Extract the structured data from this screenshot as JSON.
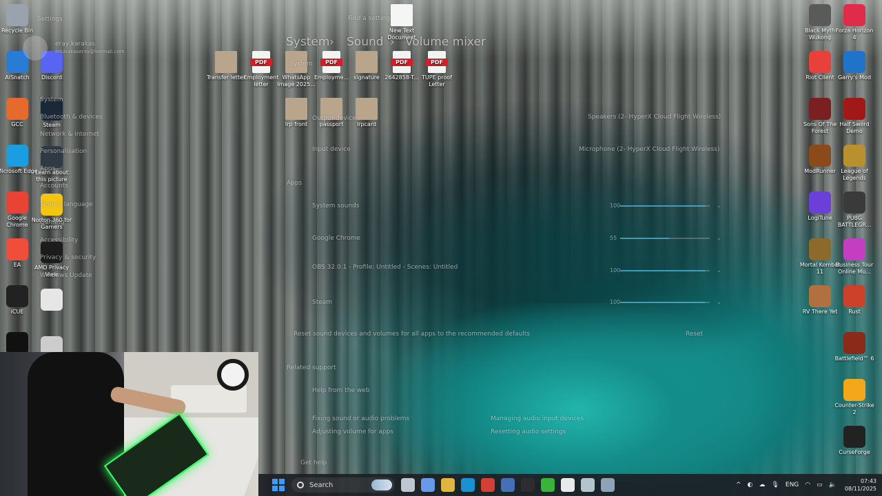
{
  "desktop": {
    "left_icons": [
      {
        "label": "Recycle Bin",
        "icon": "recycle-bin-icon",
        "color": "#9aa3ad"
      },
      {
        "label": "AISnatch",
        "icon": "aisnatch-icon",
        "color": "#2a7bd6"
      },
      {
        "label": "GCC",
        "icon": "gcc-icon",
        "color": "#e6692d"
      },
      {
        "label": "Microsoft Edge",
        "icon": "edge-icon",
        "color": "#1b9de2"
      },
      {
        "label": "Google Chrome",
        "icon": "chrome-icon",
        "color": "#e84335"
      },
      {
        "label": "EA",
        "icon": "ea-icon",
        "color": "#f04d3a"
      },
      {
        "label": "iCUE",
        "icon": "icue-icon",
        "color": "#222222"
      },
      {
        "label": "",
        "icon": "capcut-icon",
        "color": "#111111"
      }
    ],
    "second_col_icons": [
      {
        "label": "Discord",
        "icon": "discord-icon",
        "color": "#5865f2"
      },
      {
        "label": "Steam",
        "icon": "steam-icon",
        "color": "#1b2838"
      },
      {
        "label": "Learn about this picture",
        "icon": "learn-picture-icon",
        "color": "#2f3a44"
      },
      {
        "label": "Norton 360 for Gamers",
        "icon": "norton-icon",
        "color": "#f2c511"
      },
      {
        "label": "AMD Privacy View",
        "icon": "amd-privacy-icon",
        "color": "#1c1c1c"
      },
      {
        "label": "",
        "icon": "folder-icon",
        "color": "#e6e6e6"
      },
      {
        "label": "",
        "icon": "skull-icon",
        "color": "#ccc"
      }
    ],
    "top_files": [
      {
        "label": "Transfer letter",
        "type": "image"
      },
      {
        "label": "Employment letter",
        "type": "pdf"
      },
      {
        "label": "WhatsApp Image 2025...",
        "type": "image"
      },
      {
        "label": "Employme...",
        "type": "pdf"
      },
      {
        "label": "signature",
        "type": "image"
      },
      {
        "label": "2642858-T...",
        "type": "pdf"
      },
      {
        "label": "TUPE proof Letter",
        "type": "pdf"
      },
      {
        "label": "New Text Document",
        "type": "text"
      }
    ],
    "mid_files": [
      {
        "label": "Irp front",
        "type": "image"
      },
      {
        "label": "passport",
        "type": "image"
      },
      {
        "label": "irpcard",
        "type": "image"
      }
    ],
    "right_col1": [
      {
        "label": "Black Myth Wukong",
        "icon": "black-myth-icon",
        "color": "#5a5a5a"
      },
      {
        "label": "Riot Client",
        "icon": "riot-icon",
        "color": "#e8403a"
      },
      {
        "label": "Sons Of The Forest",
        "icon": "sons-forest-icon",
        "color": "#7a2020"
      },
      {
        "label": "ModRunner",
        "icon": "modrunner-icon",
        "color": "#8a4a1a"
      },
      {
        "label": "LogiTune",
        "icon": "logitune-icon",
        "color": "#6b3fd8"
      },
      {
        "label": "Mortal Kombat 11",
        "icon": "mk11-icon",
        "color": "#8c6a2a"
      },
      {
        "label": "RV There Yet",
        "icon": "rv-icon",
        "color": "#b07040"
      }
    ],
    "right_col2": [
      {
        "label": "Forza Horizon 4",
        "icon": "forza-icon",
        "color": "#e12b4a"
      },
      {
        "label": "Garry's Mod",
        "icon": "gmod-icon",
        "color": "#1f73c9"
      },
      {
        "label": "Half Sword Demo",
        "icon": "half-sword-icon",
        "color": "#a01818"
      },
      {
        "label": "League of Legends",
        "icon": "lol-icon",
        "color": "#b8912e"
      },
      {
        "label": "PUBG BATTLEGR...",
        "icon": "pubg-icon",
        "color": "#3a3a3a"
      },
      {
        "label": "Business Tour Online Mu...",
        "icon": "business-tour-icon",
        "color": "#c43fbf"
      },
      {
        "label": "Rust",
        "icon": "rust-icon",
        "color": "#cd412b"
      },
      {
        "label": "Battlefield™ 6",
        "icon": "battlefield-icon",
        "color": "#8a2a1a"
      },
      {
        "label": "Counter-Strike 2",
        "icon": "cs2-icon",
        "color": "#f2a818"
      },
      {
        "label": "CurseForge",
        "icon": "curseforge-icon",
        "color": "#222222"
      }
    ]
  },
  "settings_overlay": {
    "app_label": "Settings",
    "user_name": "eray karakas",
    "user_email": "erkarakaseray@hotmail.com",
    "find_setting": "Find a setting",
    "breadcrumb": [
      "System",
      "Sound",
      "Volume mixer"
    ],
    "nav": [
      "System",
      "Bluetooth & devices",
      "Network & internet",
      "Personalisation",
      "Apps",
      "Accounts",
      "Time & language",
      "Gaming",
      "Accessibility",
      "Privacy & security",
      "Windows Update"
    ],
    "output_device_label": "Output device",
    "output_device_value": "Speakers (2- HyperX Cloud Flight Wireless)",
    "input_device_label": "Input device",
    "input_device_value": "Microphone (2- HyperX Cloud Flight Wireless)",
    "apps_label": "Apps",
    "apps": [
      {
        "name": "System sounds",
        "value": "100",
        "level": 0.95
      },
      {
        "name": "Google Chrome",
        "value": "55",
        "level": 0.55
      },
      {
        "name": "OBS 32.0.1 - Profile: Untitled - Scenes: Untitled",
        "value": "100",
        "level": 0.95
      },
      {
        "name": "Steam",
        "value": "100",
        "level": 0.95
      }
    ],
    "reset_text": "Reset sound devices and volumes for all apps to the recommended defaults",
    "reset_button": "Reset",
    "related_support": "Related support",
    "help_web": "Help from the web",
    "help_links": [
      "Fixing sound or audio problems",
      "Managing audio input devices",
      "Adjusting volume for apps",
      "Resetting audio settings"
    ],
    "get_help": "Get help"
  },
  "taskbar": {
    "search_placeholder": "Search",
    "apps": [
      {
        "icon": "task-view-icon",
        "color": "#cfd8e3"
      },
      {
        "icon": "copilot-icon",
        "color": "#6fa8ff"
      },
      {
        "icon": "file-explorer-icon",
        "color": "#f5c542"
      },
      {
        "icon": "edge-icon",
        "color": "#1b9de2"
      },
      {
        "icon": "chrome-icon",
        "color": "#e84335"
      },
      {
        "icon": "winrar-icon",
        "color": "#4a79c8"
      },
      {
        "icon": "obs-icon",
        "color": "#302e31"
      },
      {
        "icon": "xbox-icon",
        "color": "#3ec23e"
      },
      {
        "icon": "capcut-icon",
        "color": "#ffffff"
      },
      {
        "icon": "steam-icon",
        "color": "#c7d5e0"
      },
      {
        "icon": "settings-icon",
        "color": "#9bb0c8"
      }
    ],
    "tray": {
      "language": "ENG",
      "time": "07:43",
      "date": "08/11/2025"
    }
  }
}
